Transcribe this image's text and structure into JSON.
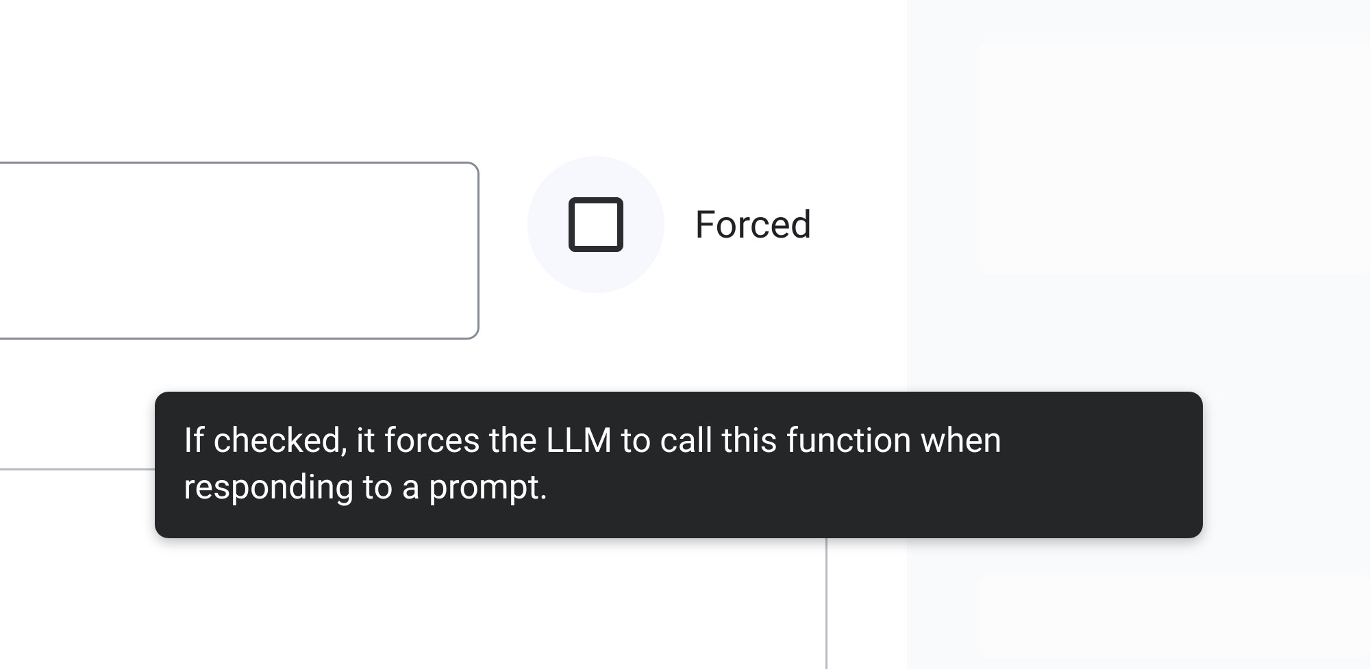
{
  "checkbox": {
    "label": "Forced",
    "checked": false
  },
  "tooltip": {
    "text": "If checked, it forces the LLM to call this function when responding to a prompt."
  }
}
